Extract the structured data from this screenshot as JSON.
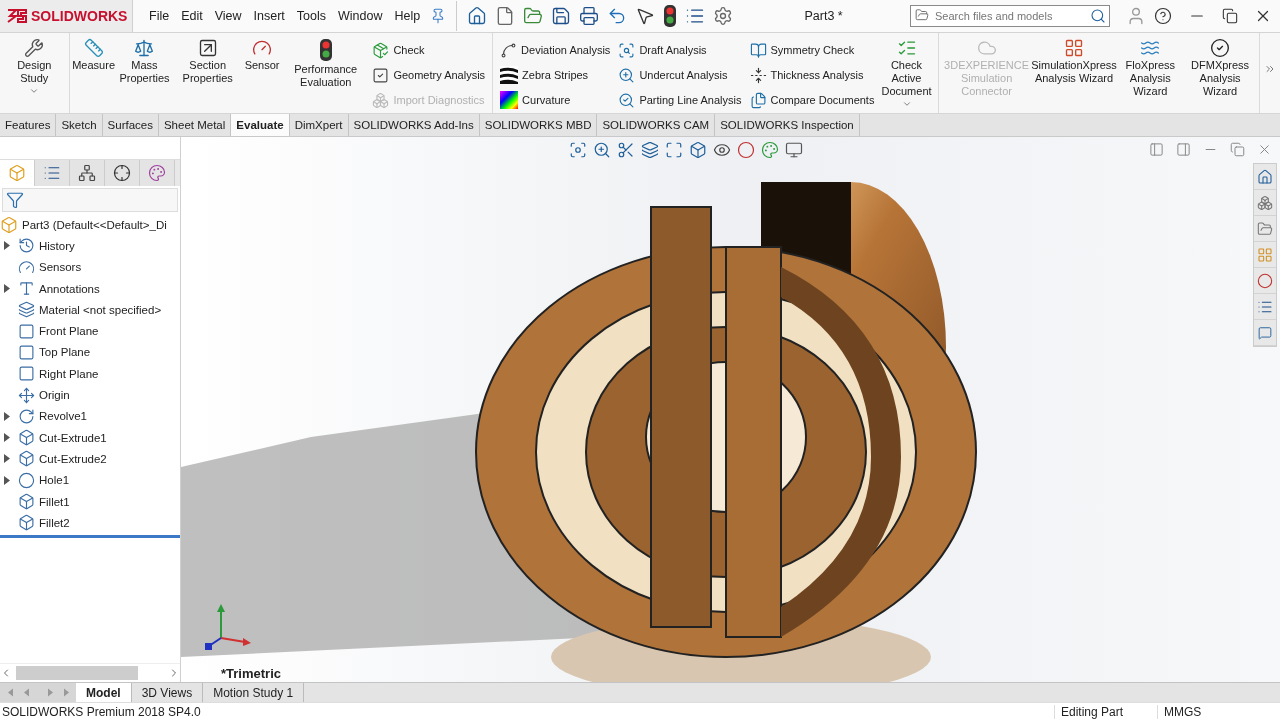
{
  "logo": {
    "text": "SOLIDWORKS"
  },
  "menu": [
    "File",
    "Edit",
    "View",
    "Insert",
    "Tools",
    "Window",
    "Help"
  ],
  "document_title": "Part3 *",
  "search": {
    "placeholder": "Search files and models"
  },
  "ribbon": [
    [
      {
        "kind": "large",
        "label": "Design Study",
        "disabled": false,
        "dropdown": true
      }
    ],
    [
      {
        "kind": "large",
        "label": "Measure",
        "disabled": false,
        "dropdown": false
      },
      {
        "kind": "large",
        "label": "Mass Properties",
        "disabled": false,
        "dropdown": false
      },
      {
        "kind": "large",
        "label": "Section Properties",
        "disabled": false,
        "dropdown": false
      },
      {
        "kind": "large",
        "label": "Sensor",
        "disabled": false,
        "dropdown": false
      },
      {
        "kind": "large",
        "label": "Performance Evaluation",
        "disabled": false,
        "dropdown": false
      },
      {
        "kind": "stack",
        "items": [
          {
            "label": "Check",
            "disabled": false
          },
          {
            "label": "Geometry Analysis",
            "disabled": false
          },
          {
            "label": "Import Diagnostics",
            "disabled": true
          }
        ]
      }
    ],
    [
      {
        "kind": "stack",
        "items": [
          {
            "label": "Deviation Analysis",
            "disabled": false
          },
          {
            "label": "Zebra Stripes",
            "disabled": false
          },
          {
            "label": "Curvature",
            "disabled": false
          }
        ]
      },
      {
        "kind": "stack",
        "items": [
          {
            "label": "Draft Analysis",
            "disabled": false
          },
          {
            "label": "Undercut Analysis",
            "disabled": false
          },
          {
            "label": "Parting Line Analysis",
            "disabled": false
          }
        ]
      },
      {
        "kind": "stack",
        "items": [
          {
            "label": "Symmetry Check",
            "disabled": false
          },
          {
            "label": "Thickness Analysis",
            "disabled": false
          },
          {
            "label": "Compare Documents",
            "disabled": false
          }
        ]
      },
      {
        "kind": "large",
        "label": "Check Active Document",
        "disabled": false,
        "dropdown": true
      }
    ],
    [
      {
        "kind": "large",
        "label": "3DEXPERIENCE Simulation Connector",
        "disabled": true,
        "dropdown": false
      },
      {
        "kind": "large",
        "label": "SimulationXpress Analysis Wizard",
        "disabled": false,
        "dropdown": false
      },
      {
        "kind": "large",
        "label": "FloXpress Analysis Wizard",
        "disabled": false,
        "dropdown": false
      },
      {
        "kind": "large",
        "label": "DFMXpress Analysis Wizard",
        "disabled": false,
        "dropdown": false
      }
    ]
  ],
  "tabs": [
    {
      "label": "Features",
      "selected": false
    },
    {
      "label": "Sketch",
      "selected": false
    },
    {
      "label": "Surfaces",
      "selected": false
    },
    {
      "label": "Sheet Metal",
      "selected": false
    },
    {
      "label": "Evaluate",
      "selected": true
    },
    {
      "label": "DimXpert",
      "selected": false
    },
    {
      "label": "SOLIDWORKS Add-Ins",
      "selected": false
    },
    {
      "label": "SOLIDWORKS MBD",
      "selected": false
    },
    {
      "label": "SOLIDWORKS CAM",
      "selected": false
    },
    {
      "label": "SOLIDWORKS Inspection",
      "selected": false
    }
  ],
  "tree": {
    "root": "Part3  (Default<<Default>_Di",
    "items": [
      {
        "label": "History",
        "expandable": true
      },
      {
        "label": "Sensors",
        "expandable": false
      },
      {
        "label": "Annotations",
        "expandable": true
      },
      {
        "label": "Material <not specified>",
        "expandable": false
      },
      {
        "label": "Front Plane",
        "expandable": false
      },
      {
        "label": "Top Plane",
        "expandable": false
      },
      {
        "label": "Right Plane",
        "expandable": false
      },
      {
        "label": "Origin",
        "expandable": false
      },
      {
        "label": "Revolve1",
        "expandable": true
      },
      {
        "label": "Cut-Extrude1",
        "expandable": true
      },
      {
        "label": "Cut-Extrude2",
        "expandable": true
      },
      {
        "label": "Hole1",
        "expandable": true
      },
      {
        "label": "Fillet1",
        "expandable": false
      },
      {
        "label": "Fillet2",
        "expandable": false
      }
    ]
  },
  "viewport": {
    "view_name": "*Trimetric"
  },
  "bottom_tabs": [
    {
      "label": "Model",
      "selected": true
    },
    {
      "label": "3D Views",
      "selected": false
    },
    {
      "label": "Motion Study 1",
      "selected": false
    }
  ],
  "status": {
    "product": "SOLIDWORKS Premium 2018 SP4.0",
    "mode": "Editing Part",
    "units": "MMGS"
  }
}
